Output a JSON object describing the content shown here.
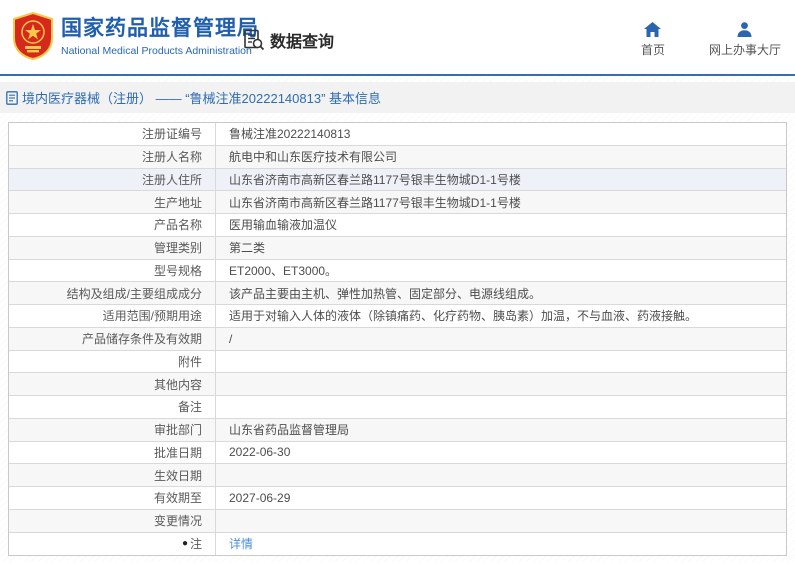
{
  "header": {
    "title": "国家药品监督管理局",
    "subtitle": "National Medical Products Administration",
    "data_query_label": "数据查询",
    "nav": {
      "home_label": "首页",
      "service_hall_label": "网上办事大厅"
    }
  },
  "breadcrumb": {
    "text": "境内医疗器械（注册） —— “鲁械注准20222140813” 基本信息"
  },
  "icons": {
    "note_glyph": "●"
  },
  "colors": {
    "brand_blue": "#1f5fae",
    "header_rule_blue": "#3a6ea5",
    "breadcrumb_blue": "#2e6cb5",
    "link_blue": "#4a90d9",
    "alt_row_gray": "#f7f7f7",
    "highlight_row": "#eef1f8",
    "emblem_red": "#d7281e",
    "emblem_gold": "#f7c948"
  },
  "table": {
    "rows": [
      {
        "label": "注册证编号",
        "value": "鲁械注准20222140813"
      },
      {
        "label": "注册人名称",
        "value": "航电中和山东医疗技术有限公司"
      },
      {
        "label": "注册人住所",
        "value": "山东省济南市高新区春兰路1177号银丰生物城D1-1号楼"
      },
      {
        "label": "生产地址",
        "value": "山东省济南市高新区春兰路1177号银丰生物城D1-1号楼"
      },
      {
        "label": "产品名称",
        "value": "医用输血输液加温仪"
      },
      {
        "label": "管理类别",
        "value": "第二类"
      },
      {
        "label": "型号规格",
        "value": "ET2000、ET3000。"
      },
      {
        "label": "结构及组成/主要组成成分",
        "value": "该产品主要由主机、弹性加热管、固定部分、电源线组成。"
      },
      {
        "label": "适用范围/预期用途",
        "value": "适用于对输入人体的液体（除镇痛药、化疗药物、胰岛素）加温，不与血液、药液接触。"
      },
      {
        "label": "产品储存条件及有效期",
        "value": "/"
      },
      {
        "label": "附件",
        "value": ""
      },
      {
        "label": "其他内容",
        "value": ""
      },
      {
        "label": "备注",
        "value": ""
      },
      {
        "label": "审批部门",
        "value": "山东省药品监督管理局"
      },
      {
        "label": "批准日期",
        "value": "2022-06-30"
      },
      {
        "label": "生效日期",
        "value": ""
      },
      {
        "label": "有效期至",
        "value": "2027-06-29"
      },
      {
        "label": "变更情况",
        "value": ""
      },
      {
        "label": "注",
        "value": "详情"
      }
    ]
  }
}
